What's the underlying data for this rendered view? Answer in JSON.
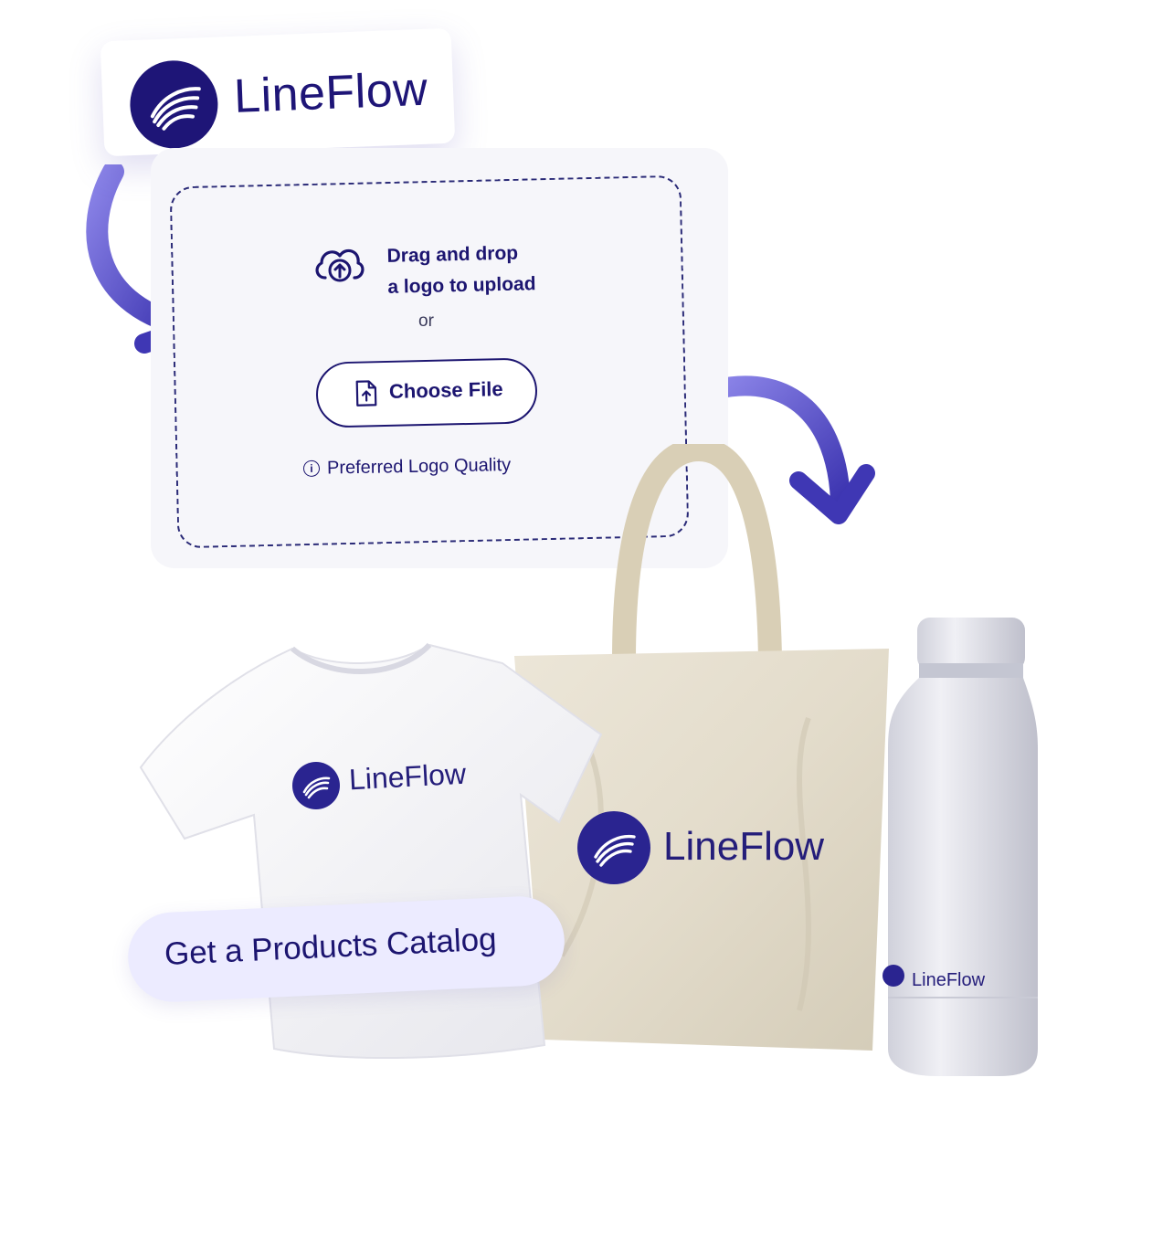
{
  "brand": {
    "name": "LineFlow",
    "icon": "lineflow-swoosh-icon"
  },
  "upload": {
    "icon": "cloud-upload-icon",
    "drag_line1": "Drag and drop",
    "drag_line2": "a logo to upload",
    "or_text": "or",
    "choose_file_icon": "file-upload-icon",
    "choose_file_label": "Choose File",
    "info_icon": "info-icon",
    "quality_link": "Preferred Logo Quality"
  },
  "products": {
    "tshirt_brand": "LineFlow",
    "tote_brand": "LineFlow",
    "bottle_brand": "LineFlow"
  },
  "cta": {
    "label": "Get a Products Catalog"
  },
  "colors": {
    "brand_navy": "#1e1577",
    "arrow_purple": "#5b53c8",
    "panel_bg": "#f6f6fa",
    "cta_bg": "#ecebff"
  }
}
